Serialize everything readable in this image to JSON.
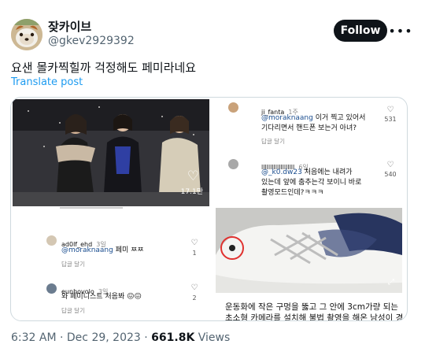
{
  "author": {
    "display_name": "잦카이브",
    "handle": "@gkev2929392",
    "follow_label": "Follow"
  },
  "tweet": {
    "text": "요샌 몰카찍힐까 걱정해도 페미라네요",
    "translate_label": "Translate post"
  },
  "media": {
    "video_like_count": "17.1만",
    "comments_left": [
      {
        "name": "ad0lf_ehd",
        "time": "3일",
        "mention": "@moraknaang",
        "text": " 페미 ㅉㅉ",
        "likes": "1",
        "reply": "답글 달기"
      },
      {
        "name": "eunhovolo",
        "time": "3일",
        "mention": "",
        "text": "와 페미니스트 처음봐 😖😖",
        "likes": "2",
        "reply": "답글 달기"
      }
    ],
    "comments_right": [
      {
        "name": "ji_fanta",
        "time": "1주",
        "mention": "@moraknaang",
        "text_line1": " 이거 찍고 있어서",
        "text_line2": "기다리면서 핸드폰 보는거 아녀?",
        "likes": "531",
        "reply": "답글 달기"
      },
      {
        "name": "lllllllllllllllllll",
        "time": "6일",
        "mention": "@_k0.dw23",
        "text_line1": " 처음에는 내려가",
        "text_line2": "있는데 앞에 춤추는각 보이니 바로",
        "text_line3": "촬영모드인데?ㅋㅋㅋ",
        "likes": "540",
        "reply": "답글 달기"
      }
    ],
    "caption_line1": "운동화에 작은 구멍을 뚫고 그 안에 3cm가량 되는",
    "caption_line2": "초소형 카메라를 설치해 불법 촬영을 해온 남성이 경"
  },
  "footer": {
    "time": "6:32 AM",
    "separator": "·",
    "date": "Dec 29, 2023",
    "views_count": "661.8K",
    "views_label": "Views"
  },
  "colors": {
    "accent": "#1d9bf0",
    "follow_bg": "#0f1419",
    "mention": "#1a4d8f",
    "highlight_circle": "#e0312f"
  }
}
